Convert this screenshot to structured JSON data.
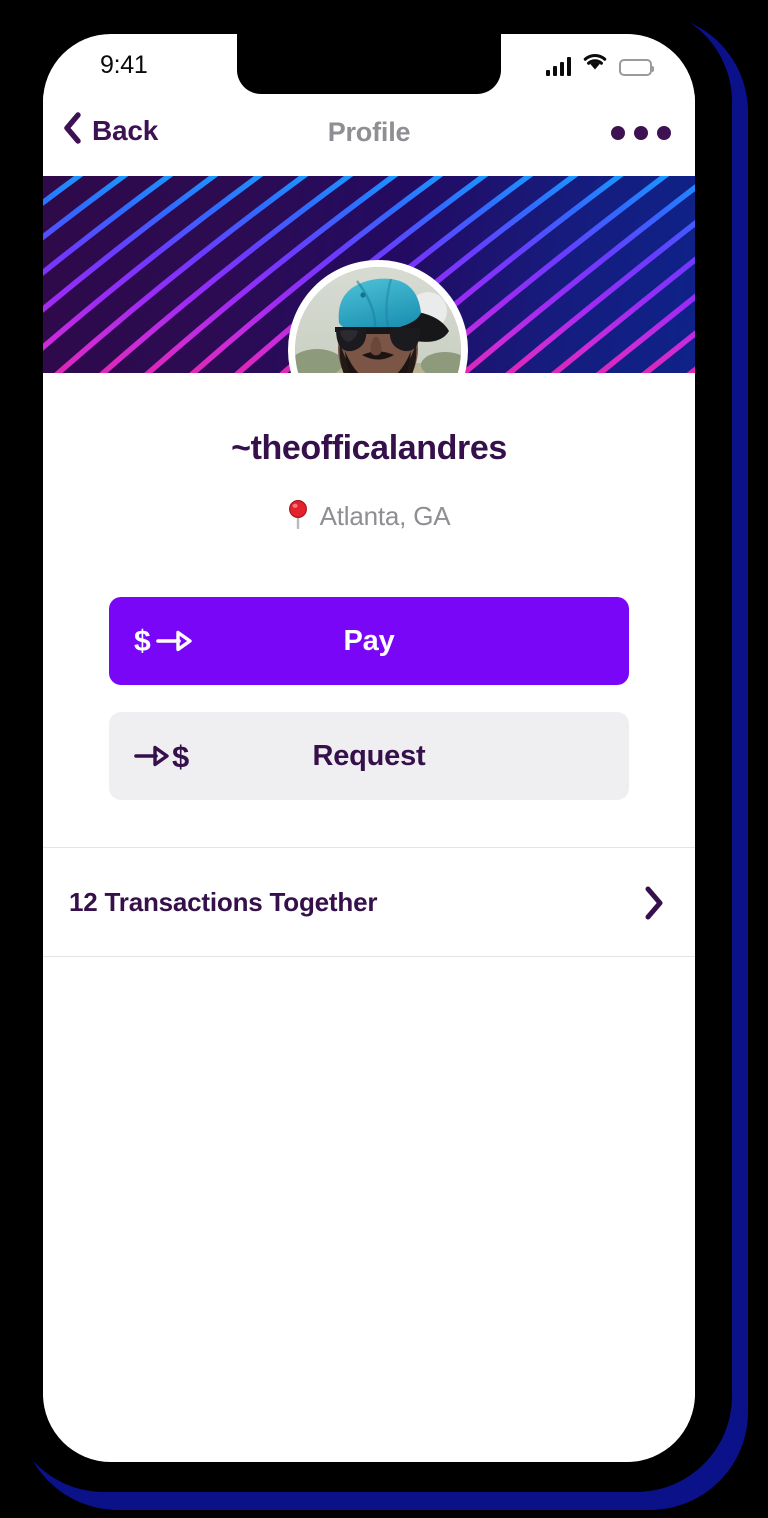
{
  "status_bar": {
    "time": "9:41",
    "signal_icon": "cellular-signal-icon",
    "wifi_icon": "wifi-icon",
    "battery_icon": "battery-full-icon"
  },
  "nav": {
    "back_label": "Back",
    "back_icon": "chevron-left-icon",
    "title": "Profile",
    "more_icon": "more-horizontal-icon"
  },
  "profile": {
    "username": "~theofficalandres",
    "location": "Atlanta, GA",
    "location_icon": "map-pin-icon",
    "avatar_alt": "avatar"
  },
  "actions": {
    "pay": {
      "label": "Pay",
      "icon": "dollar-arrow-right-icon"
    },
    "request": {
      "label": "Request",
      "icon": "arrow-right-dollar-icon"
    }
  },
  "transactions": {
    "label": "12 Transactions Together",
    "chevron_icon": "chevron-right-icon"
  },
  "colors": {
    "accent_purple": "#7A06F7",
    "dark_purple": "#35104A",
    "muted_gray": "#8E8E93",
    "surface_gray": "#EFEFF2",
    "divider": "#E4E4E8",
    "banner_magenta": "#E02FC8",
    "banner_violet": "#8A2BF0",
    "banner_blue": "#2F6BFF",
    "banner_cyan": "#12A5FF",
    "shadow_navy": "#0A1189"
  }
}
